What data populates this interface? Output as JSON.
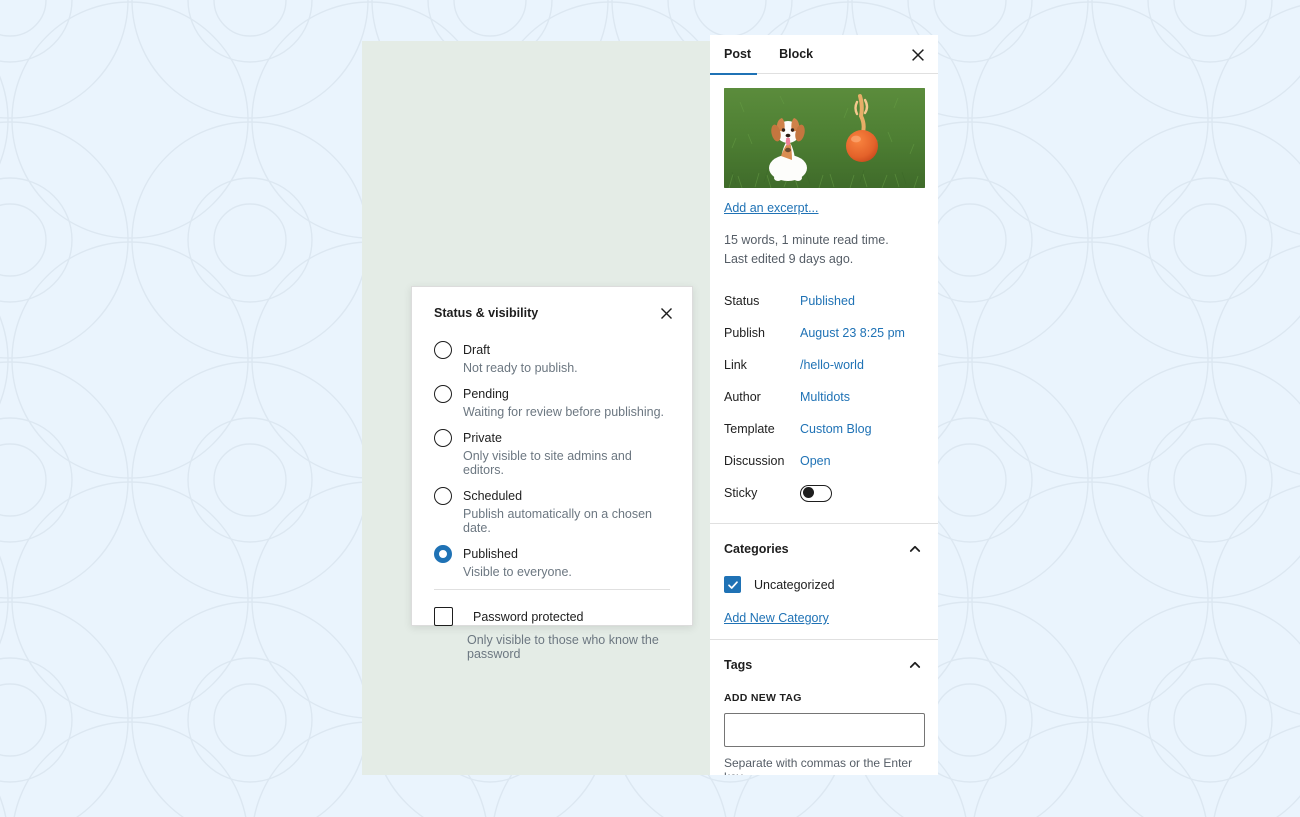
{
  "sidebar": {
    "tabs": [
      {
        "label": "Post",
        "active": true
      },
      {
        "label": "Block",
        "active": false
      }
    ],
    "close_label": "✕",
    "featured_image_alt": "dog-on-grass-with-orange-ball",
    "excerpt_link": "Add an excerpt...",
    "stats": {
      "words": "15 words, 1 minute read time.",
      "last_edited": "Last edited 9 days ago."
    },
    "meta": [
      {
        "label": "Status",
        "value": "Published",
        "type": "link"
      },
      {
        "label": "Publish",
        "value": "August 23 8:25 pm",
        "type": "link"
      },
      {
        "label": "Link",
        "value": "/hello-world",
        "type": "link"
      },
      {
        "label": "Author",
        "value": "Multidots",
        "type": "link"
      },
      {
        "label": "Template",
        "value": "Custom Blog",
        "type": "link"
      },
      {
        "label": "Discussion",
        "value": "Open",
        "type": "link"
      },
      {
        "label": "Sticky",
        "value": "",
        "type": "toggle",
        "checked": false
      }
    ],
    "categories": {
      "title": "Categories",
      "items": [
        {
          "label": "Uncategorized",
          "checked": true
        }
      ],
      "add_link": "Add New Category"
    },
    "tags": {
      "title": "Tags",
      "field_label": "ADD NEW TAG",
      "input_value": "",
      "input_placeholder": "",
      "help_text": "Separate with commas or the Enter key."
    }
  },
  "dialog": {
    "title": "Status & visibility",
    "close_label": "✕",
    "options": [
      {
        "label": "Draft",
        "help": "Not ready to publish.",
        "checked": false
      },
      {
        "label": "Pending",
        "help": "Waiting for review before publishing.",
        "checked": false
      },
      {
        "label": "Private",
        "help": "Only visible to site admins and editors.",
        "checked": false
      },
      {
        "label": "Scheduled",
        "help": "Publish automatically on a chosen date.",
        "checked": false
      },
      {
        "label": "Published",
        "help": "Visible to everyone.",
        "checked": true
      }
    ],
    "password": {
      "label": "Password protected",
      "help": "Only visible to those who know the password",
      "checked": false
    }
  },
  "colors": {
    "accent": "#1f72b5",
    "background": "#eaf4fd",
    "canvas": "#e4ece6",
    "pattern_stroke": "#dde7f0"
  }
}
